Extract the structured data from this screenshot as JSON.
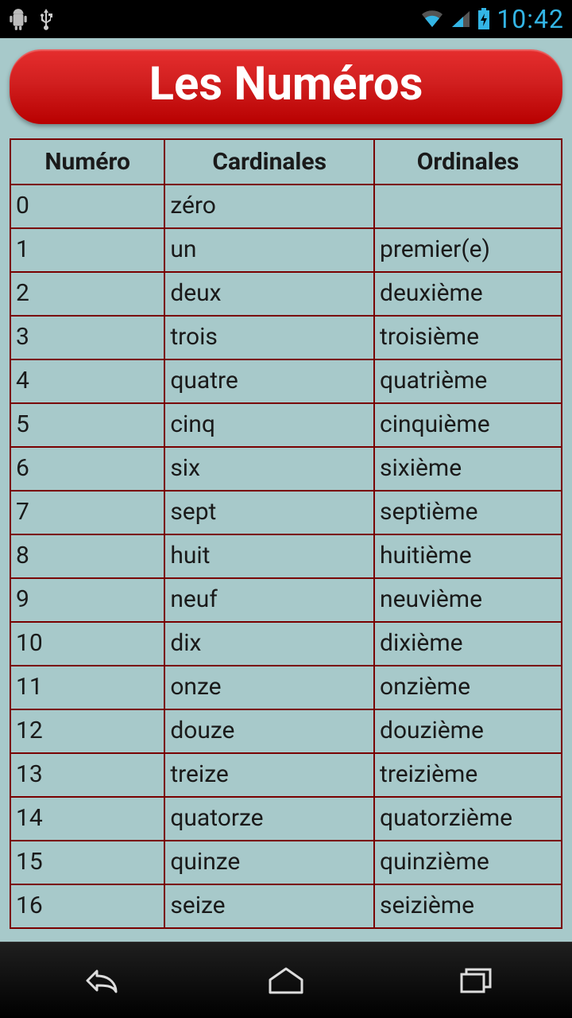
{
  "status": {
    "time": "10:42"
  },
  "title": "Les Numéros",
  "headers": {
    "numero": "Numéro",
    "cardinales": "Cardinales",
    "ordinales": "Ordinales"
  },
  "rows": [
    {
      "n": "0",
      "c": "zéro",
      "o": ""
    },
    {
      "n": "1",
      "c": "un",
      "o": "premier(e)"
    },
    {
      "n": "2",
      "c": "deux",
      "o": "deuxième"
    },
    {
      "n": "3",
      "c": "trois",
      "o": "troisième"
    },
    {
      "n": "4",
      "c": "quatre",
      "o": "quatrième"
    },
    {
      "n": "5",
      "c": "cinq",
      "o": "cinquième"
    },
    {
      "n": "6",
      "c": "six",
      "o": "sixième"
    },
    {
      "n": "7",
      "c": "sept",
      "o": "septième"
    },
    {
      "n": "8",
      "c": "huit",
      "o": "huitième"
    },
    {
      "n": "9",
      "c": "neuf",
      "o": "neuvième"
    },
    {
      "n": "10",
      "c": "dix",
      "o": "dixième"
    },
    {
      "n": "11",
      "c": "onze",
      "o": "onzième"
    },
    {
      "n": "12",
      "c": "douze",
      "o": "douzième"
    },
    {
      "n": "13",
      "c": "treize",
      "o": "treizième"
    },
    {
      "n": "14",
      "c": "quatorze",
      "o": "quatorzième"
    },
    {
      "n": "15",
      "c": "quinze",
      "o": "quinzième"
    },
    {
      "n": "16",
      "c": "seize",
      "o": "seizième"
    }
  ]
}
